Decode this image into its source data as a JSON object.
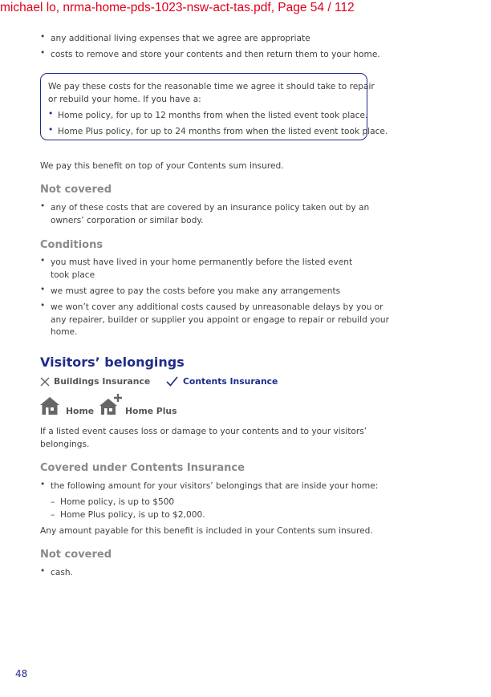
{
  "header": {
    "title": "michael lo, nrma-home-pds-1023-nsw-act-tas.pdf, Page 54 / 112"
  },
  "bullet_char": "•",
  "dash_char": "–",
  "top_list": [
    "any additional living expenses that we agree are appropriate",
    "costs to remove and store your contents and then return them to your home."
  ],
  "box": {
    "intro_line1": "We pay these costs for the reasonable time we agree it should take to repair",
    "intro_line2": "or rebuild your home. If you have a:",
    "items": [
      "Home policy, for up to 12 months from when the listed event took place.",
      "Home Plus policy, for up to 24 months from when the listed event took place."
    ]
  },
  "benefit_note": "We pay this benefit on top of your Contents sum insured.",
  "not_covered_1": {
    "heading": "Not covered",
    "item_line1": "any of these costs that are covered by an insurance policy taken out by an",
    "item_line2": "owners’ corporation or similar body."
  },
  "conditions": {
    "heading": "Conditions",
    "items": [
      {
        "line1": "you must have lived in your home permanently before the listed event",
        "line2": "took place"
      },
      {
        "line1": "we must agree to pay the costs before you make any arrangements"
      },
      {
        "line1": "we won’t cover any additional costs caused by unreasonable delays by you or",
        "line2": "any repairer, builder or supplier you appoint or engage to repair or rebuild your",
        "line3": "home."
      }
    ]
  },
  "visitors": {
    "title": "Visitors’ belongings",
    "buildings_label": "Buildings Insurance",
    "contents_label": "Contents Insurance",
    "home_label": "Home",
    "home_plus_label": "Home Plus",
    "intro_line1": "If a listed event causes loss or damage to your contents and to your visitors’",
    "intro_line2": "belongings.",
    "covered_heading": "Covered under Contents Insurance",
    "covered_item": "the following amount for your visitors’ belongings that are inside your home:",
    "sub_items": [
      "Home policy, is up to $500",
      "Home Plus policy, is up to $2,000."
    ],
    "note": "Any amount payable for this benefit is included in your Contents sum insured.",
    "not_covered_heading": "Not covered",
    "not_covered_item": "cash."
  },
  "page_number": "48",
  "colors": {
    "brand_blue": "#1f2c8a",
    "header_red": "#e0001b",
    "icon_gray": "#666666",
    "heading_gray": "#8a8a8a"
  }
}
